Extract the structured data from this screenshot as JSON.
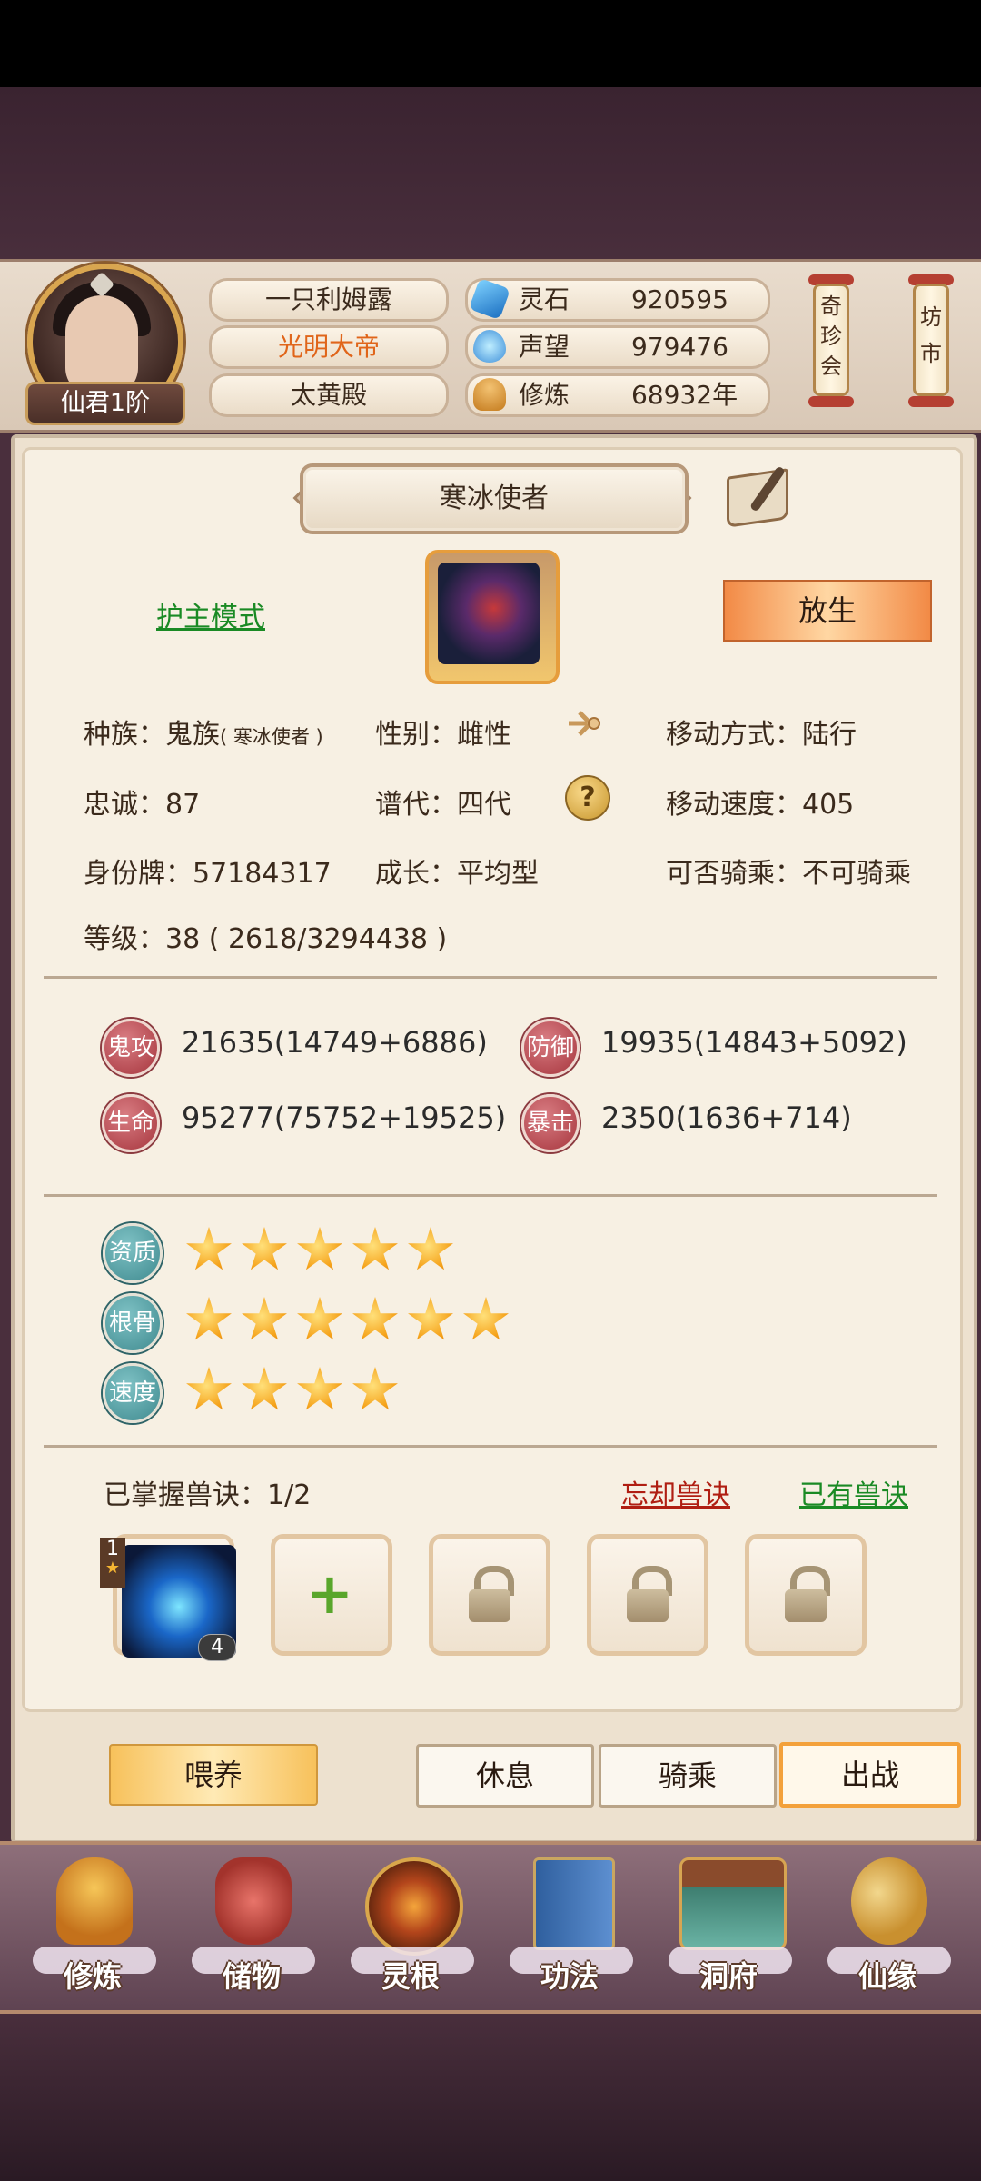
{
  "header": {
    "player_rank": "仙君1阶",
    "names": [
      "一只利姆露",
      "光明大帝",
      "太黄殿"
    ],
    "resources": [
      {
        "label": "灵石",
        "value": "920595",
        "icon": "spirit-stone-icon"
      },
      {
        "label": "声望",
        "value": "979476",
        "icon": "reputation-icon"
      },
      {
        "label": "修炼",
        "value": "68932年",
        "icon": "cultivation-icon"
      }
    ],
    "shops": [
      {
        "label": "奇\n珍\n会"
      },
      {
        "label": "坊\n市"
      }
    ]
  },
  "pet": {
    "title": "寒冰使者",
    "mode_link": "护主模式",
    "release_label": "放生",
    "info": {
      "race": "种族：鬼族",
      "race_sub": "( 寒冰使者 )",
      "gender": "性别：雌性",
      "move_type": "移动方式：陆行",
      "loyalty": "忠诚：87",
      "generation": "谱代：四代",
      "move_speed": "移动速度：405",
      "id_tag": "身份牌：57184317",
      "growth": "成长：平均型",
      "rideable": "可否骑乘：不可骑乘",
      "level": "等级：38 ( 2618/3294438 )"
    },
    "help_glyph": "?",
    "stats": [
      {
        "badge": "鬼攻",
        "value": "21635(14749+6886)"
      },
      {
        "badge": "防御",
        "value": "19935(14843+5092)"
      },
      {
        "badge": "生命",
        "value": "95277(75752+19525)"
      },
      {
        "badge": "暴击",
        "value": "2350(1636+714)"
      }
    ],
    "ratings": [
      {
        "label": "资质",
        "stars": 5
      },
      {
        "label": "根骨",
        "stars": 6
      },
      {
        "label": "速度",
        "stars": 4
      }
    ],
    "skills": {
      "mastered": "已掌握兽诀：1/2",
      "forget_link": "忘却兽诀",
      "owned_link": "已有兽诀",
      "slot1_rank": "1",
      "slot1_level": "4",
      "add_glyph": "+"
    }
  },
  "actions": {
    "feed": "喂养",
    "rest": "休息",
    "ride": "骑乘",
    "fight": "出战"
  },
  "nav": [
    {
      "label": "修炼",
      "icon": "meditation-icon"
    },
    {
      "label": "储物",
      "icon": "storage-bag-icon"
    },
    {
      "label": "灵根",
      "icon": "spirit-root-icon"
    },
    {
      "label": "功法",
      "icon": "scripture-book-icon"
    },
    {
      "label": "洞府",
      "icon": "cave-mansion-icon"
    },
    {
      "label": "仙缘",
      "icon": "immortal-fate-icon"
    }
  ],
  "colors": {
    "accent_orange": "#f28a46",
    "link_green": "#1a8a24",
    "link_red": "#b01e12",
    "emperor_name": "#e0651a"
  }
}
